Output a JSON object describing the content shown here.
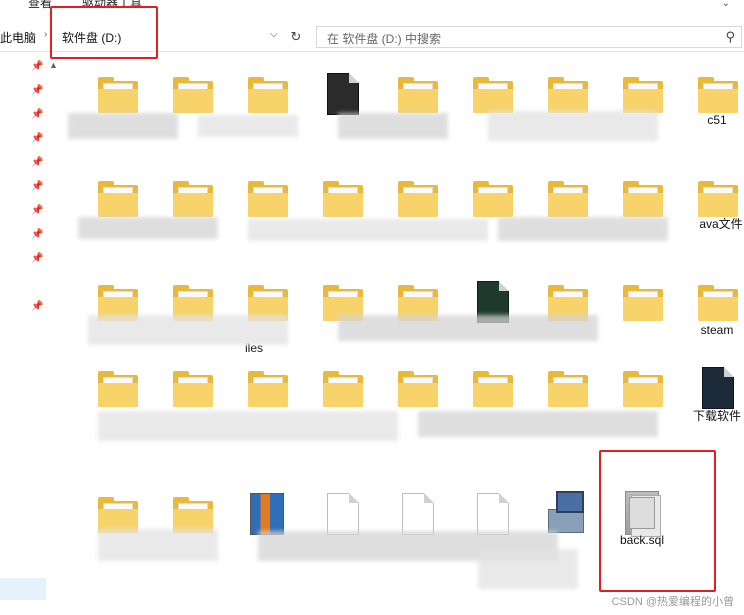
{
  "ribbon": {
    "view_label": "查看",
    "drive_tools_label": "驱动器工具"
  },
  "address": {
    "breadcrumb_pc": "此电脑",
    "breadcrumb_drive": "软件盘 (D:)",
    "search_placeholder": "在 软件盘 (D:) 中搜索"
  },
  "nav": {
    "pin_count": 10
  },
  "items": {
    "c51": "c51",
    "java": "ava文件",
    "steam": "steam",
    "files": "iles",
    "downloads": "下载软件",
    "sql_file": "back.sql"
  },
  "watermark": "CSDN @热爱编程的小曾",
  "colors": {
    "annotation_red": "#e02020",
    "folder_yellow": "#e8b93a"
  }
}
